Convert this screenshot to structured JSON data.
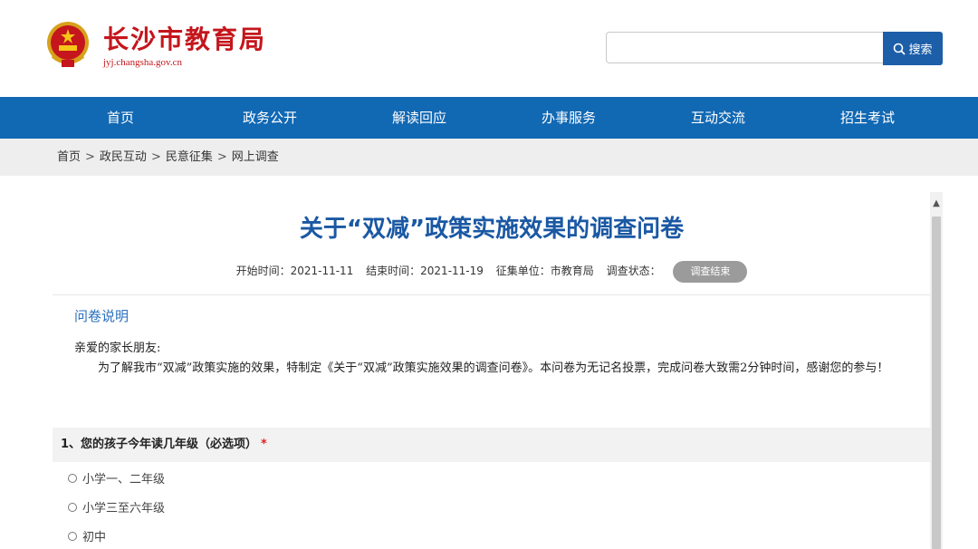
{
  "header": {
    "site_name": "长沙市教育局",
    "site_domain": "jyj.changsha.gov.cn",
    "search": {
      "placeholder": "",
      "button_label": "搜索",
      "icon": "search-icon"
    }
  },
  "nav": {
    "items": [
      {
        "label": "首页"
      },
      {
        "label": "政务公开"
      },
      {
        "label": "解读回应"
      },
      {
        "label": "办事服务"
      },
      {
        "label": "互动交流"
      },
      {
        "label": "招生考试"
      }
    ]
  },
  "breadcrumb": {
    "items": [
      "首页",
      "政民互动",
      "民意征集",
      "网上调查"
    ],
    "separator": ">"
  },
  "survey": {
    "title": "关于“双减”政策实施效果的调查问卷",
    "start": "开始时间：2021-11-11",
    "end": "结束时间：2021-11-19",
    "org": "征集单位：市教育局",
    "status_label": "调查状态：",
    "status": "调查结束",
    "intro_heading": "问卷说明",
    "intro_greeting": "亲爱的家长朋友:",
    "intro_body": "为了解我市“双减”政策实施的效果，特制定《关于“双减”政策实施效果的调查问卷》。本问卷为无记名投票，完成问卷大致需2分钟时间，感谢您的参与！",
    "question1": {
      "text": "1、您的孩子今年读几年级（必选项）",
      "required_mark": "*",
      "options": [
        "小学一、二年级",
        "小学三至六年级",
        "初中"
      ]
    }
  },
  "colors": {
    "brand_red": "#c4161c",
    "nav_blue": "#1168b3",
    "title_blue": "#1a58a3",
    "search_blue": "#1c5ea8"
  }
}
